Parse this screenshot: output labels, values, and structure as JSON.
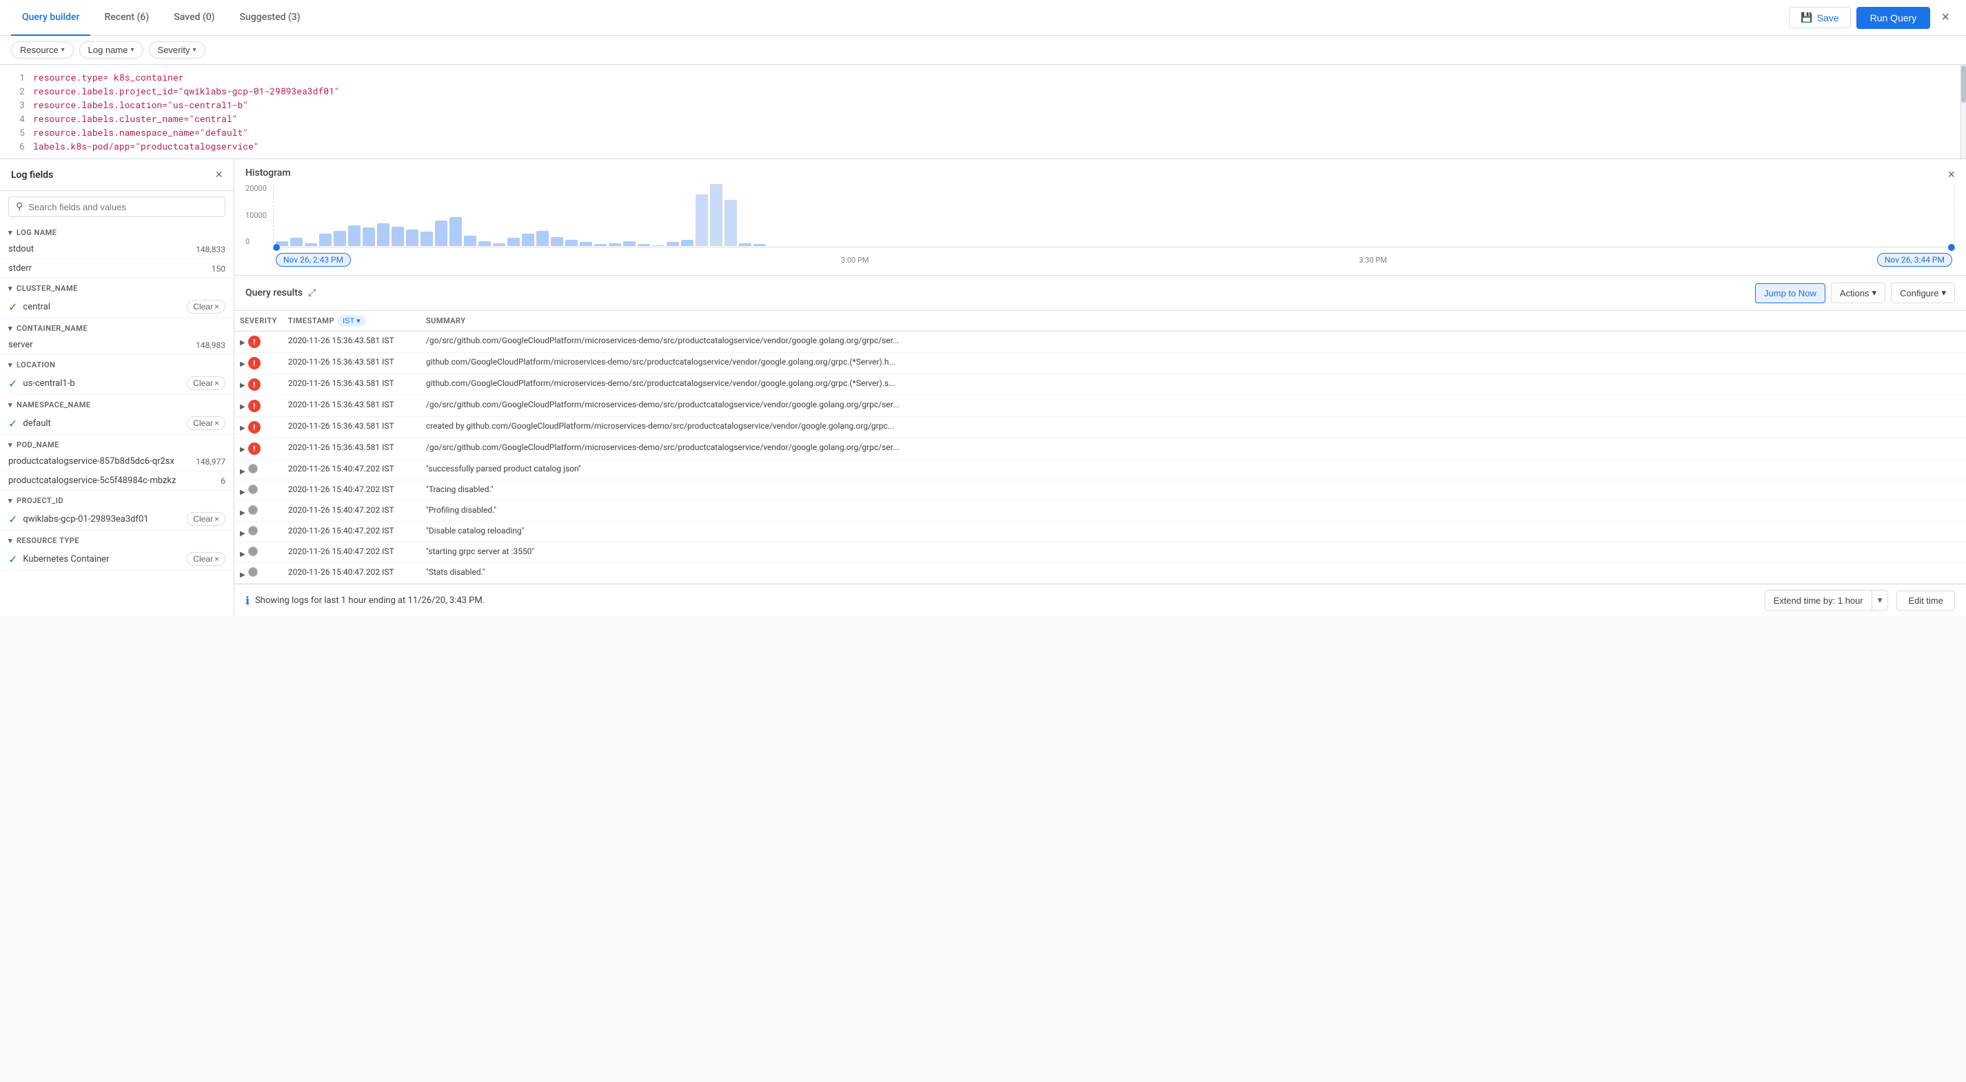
{
  "header": {
    "tabs": [
      {
        "label": "Query builder",
        "active": true
      },
      {
        "label": "Recent (6)",
        "active": false
      },
      {
        "label": "Saved (0)",
        "active": false
      },
      {
        "label": "Suggested (3)",
        "active": false
      }
    ],
    "save_label": "Save",
    "run_query_label": "Run Query",
    "close_label": "×"
  },
  "filters": [
    {
      "label": "Resource",
      "id": "resource"
    },
    {
      "label": "Log name",
      "id": "log-name"
    },
    {
      "label": "Severity",
      "id": "severity"
    }
  ],
  "code_lines": [
    {
      "num": 1,
      "text": "resource.type= k8s_container"
    },
    {
      "num": 2,
      "text": "resource.labels.project_id=\"qwiklabs-gcp-01-29893ea3df01\""
    },
    {
      "num": 3,
      "text": "resource.labels.location=\"us-central1-b\""
    },
    {
      "num": 4,
      "text": "resource.labels.cluster_name=\"central\""
    },
    {
      "num": 5,
      "text": "resource.labels.namespace_name=\"default\""
    },
    {
      "num": 6,
      "text": "labels.k8s-pod/app=\"productcatalogservice\""
    }
  ],
  "log_fields": {
    "title": "Log fields",
    "search_placeholder": "Search fields and values",
    "sections": [
      {
        "name": "LOG NAME",
        "expanded": true,
        "items": [
          {
            "name": "stdout",
            "count": "148,833",
            "active": false,
            "has_clear": false
          },
          {
            "name": "stderr",
            "count": "150",
            "active": false,
            "has_clear": false
          }
        ]
      },
      {
        "name": "CLUSTER_NAME",
        "expanded": true,
        "items": [
          {
            "name": "central",
            "count": "",
            "active": true,
            "has_clear": true
          }
        ]
      },
      {
        "name": "CONTAINER_NAME",
        "expanded": true,
        "items": [
          {
            "name": "server",
            "count": "148,983",
            "active": false,
            "has_clear": false
          }
        ]
      },
      {
        "name": "LOCATION",
        "expanded": true,
        "items": [
          {
            "name": "us-central1-b",
            "count": "",
            "active": true,
            "has_clear": true
          }
        ]
      },
      {
        "name": "NAMESPACE_NAME",
        "expanded": true,
        "items": [
          {
            "name": "default",
            "count": "",
            "active": true,
            "has_clear": true
          }
        ]
      },
      {
        "name": "POD_NAME",
        "expanded": true,
        "items": [
          {
            "name": "productcatalogservice-857b8d5dc6-qr2sx",
            "count": "148,977",
            "active": false,
            "has_clear": false
          },
          {
            "name": "productcatalogservice-5c5f48984c-mbzkz",
            "count": "6",
            "active": false,
            "has_clear": false
          }
        ]
      },
      {
        "name": "PROJECT_ID",
        "expanded": true,
        "items": [
          {
            "name": "qwiklabs-gcp-01-29893ea3df01",
            "count": "",
            "active": true,
            "has_clear": true
          }
        ]
      },
      {
        "name": "RESOURCE TYPE",
        "expanded": true,
        "items": [
          {
            "name": "Kubernetes Container",
            "count": "",
            "active": true,
            "has_clear": true
          }
        ]
      }
    ]
  },
  "histogram": {
    "title": "Histogram",
    "y_labels": [
      "20000",
      "10000",
      "0"
    ],
    "bars": [
      {
        "height": 5,
        "selected": false
      },
      {
        "height": 8,
        "selected": false
      },
      {
        "height": 3,
        "selected": false
      },
      {
        "height": 12,
        "selected": false
      },
      {
        "height": 15,
        "selected": false
      },
      {
        "height": 20,
        "selected": false
      },
      {
        "height": 18,
        "selected": false
      },
      {
        "height": 22,
        "selected": false
      },
      {
        "height": 19,
        "selected": false
      },
      {
        "height": 16,
        "selected": false
      },
      {
        "height": 14,
        "selected": false
      },
      {
        "height": 25,
        "selected": false
      },
      {
        "height": 28,
        "selected": false
      },
      {
        "height": 10,
        "selected": false
      },
      {
        "height": 5,
        "selected": false
      },
      {
        "height": 3,
        "selected": false
      },
      {
        "height": 8,
        "selected": false
      },
      {
        "height": 12,
        "selected": false
      },
      {
        "height": 15,
        "selected": false
      },
      {
        "height": 9,
        "selected": false
      },
      {
        "height": 6,
        "selected": false
      },
      {
        "height": 4,
        "selected": false
      },
      {
        "height": 2,
        "selected": false
      },
      {
        "height": 3,
        "selected": false
      },
      {
        "height": 5,
        "selected": false
      },
      {
        "height": 2,
        "selected": false
      },
      {
        "height": 1,
        "selected": false
      },
      {
        "height": 4,
        "selected": false
      },
      {
        "height": 6,
        "selected": false
      },
      {
        "height": 50,
        "selected": true
      },
      {
        "height": 60,
        "selected": true
      },
      {
        "height": 45,
        "selected": true
      },
      {
        "height": 3,
        "selected": false
      },
      {
        "height": 2,
        "selected": false
      }
    ],
    "time_start": "Nov 26, 2:43 PM",
    "time_mid": "3:00 PM",
    "time_mid2": "3:30 PM",
    "time_end": "Nov 26, 3:44 PM"
  },
  "query_results": {
    "title": "Query results",
    "jump_to_now_label": "Jump to Now",
    "actions_label": "Actions",
    "configure_label": "Configure",
    "columns": [
      "SEVERITY",
      "TIMESTAMP",
      "IST",
      "SUMMARY"
    ],
    "rows": [
      {
        "severity": "error",
        "timestamp": "2020-11-26 15:36:43.581",
        "tz": "IST",
        "summary": "/go/src/github.com/GoogleCloudPlatform/microservices-demo/src/productcatalogservice/vendor/google.golang.org/grpc/ser..."
      },
      {
        "severity": "error",
        "timestamp": "2020-11-26 15:36:43.581",
        "tz": "IST",
        "summary": "github.com/GoogleCloudPlatform/microservices-demo/src/productcatalogservice/vendor/google.golang.org/grpc.(*Server).h..."
      },
      {
        "severity": "error",
        "timestamp": "2020-11-26 15:36:43.581",
        "tz": "IST",
        "summary": "github.com/GoogleCloudPlatform/microservices-demo/src/productcatalogservice/vendor/google.golang.org/grpc.(*Server).s..."
      },
      {
        "severity": "error",
        "timestamp": "2020-11-26 15:36:43.581",
        "tz": "IST",
        "summary": "/go/src/github.com/GoogleCloudPlatform/microservices-demo/src/productcatalogservice/vendor/google.golang.org/grpc/ser..."
      },
      {
        "severity": "error",
        "timestamp": "2020-11-26 15:36:43.581",
        "tz": "IST",
        "summary": "created by github.com/GoogleCloudPlatform/microservices-demo/src/productcatalogservice/vendor/google.golang.org/grpc..."
      },
      {
        "severity": "error",
        "timestamp": "2020-11-26 15:36:43.581",
        "tz": "IST",
        "summary": "/go/src/github.com/GoogleCloudPlatform/microservices-demo/src/productcatalogservice/vendor/google.golang.org/grpc/ser..."
      },
      {
        "severity": "info",
        "timestamp": "2020-11-26 15:40:47.202",
        "tz": "IST",
        "summary": "\"successfully parsed product catalog json\""
      },
      {
        "severity": "info",
        "timestamp": "2020-11-26 15:40:47.202",
        "tz": "IST",
        "summary": "\"Tracing disabled.\""
      },
      {
        "severity": "info",
        "timestamp": "2020-11-26 15:40:47.202",
        "tz": "IST",
        "summary": "\"Profiling disabled.\""
      },
      {
        "severity": "info",
        "timestamp": "2020-11-26 15:40:47.202",
        "tz": "IST",
        "summary": "\"Disable catalog reloading\""
      },
      {
        "severity": "info",
        "timestamp": "2020-11-26 15:40:47.202",
        "tz": "IST",
        "summary": "\"starting grpc server at :3550\""
      },
      {
        "severity": "info",
        "timestamp": "2020-11-26 15:40:47.202",
        "tz": "IST",
        "summary": "\"Stats disabled.\""
      }
    ],
    "footer": {
      "message": "Showing logs for last 1 hour ending at 11/26/20, 3:43 PM.",
      "extend_label": "Extend time by: 1 hour",
      "edit_time_label": "Edit time"
    }
  }
}
